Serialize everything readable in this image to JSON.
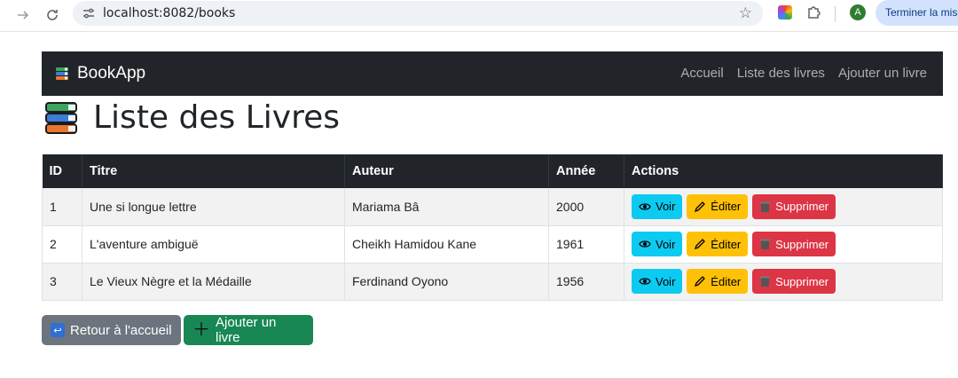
{
  "browser": {
    "url": "localhost:8082/books",
    "profile_initial": "A",
    "update_label": "Terminer la mise à jour"
  },
  "navbar": {
    "brand": "BookApp",
    "links": [
      "Accueil",
      "Liste des livres",
      "Ajouter un livre"
    ]
  },
  "page_title": "Liste des Livres",
  "table": {
    "headers": [
      "ID",
      "Titre",
      "Auteur",
      "Année",
      "Actions"
    ],
    "rows": [
      {
        "id": "1",
        "titre": "Une si longue lettre",
        "auteur": "Mariama Bâ",
        "annee": "2000"
      },
      {
        "id": "2",
        "titre": "L'aventure ambiguë",
        "auteur": "Cheikh Hamidou Kane",
        "annee": "1961"
      },
      {
        "id": "3",
        "titre": "Le Vieux Nègre et la Médaille",
        "auteur": "Ferdinand Oyono",
        "annee": "1956"
      }
    ],
    "actions": {
      "view": "Voir",
      "edit": "Éditer",
      "delete": "Supprimer"
    }
  },
  "buttons": {
    "back": "Retour à l'accueil",
    "add": "Ajouter un livre"
  },
  "colors": {
    "navbar": "#212529",
    "view": "#0dcaf0",
    "edit": "#ffc107",
    "delete": "#dc3545",
    "back": "#6c757d",
    "add": "#198754"
  }
}
